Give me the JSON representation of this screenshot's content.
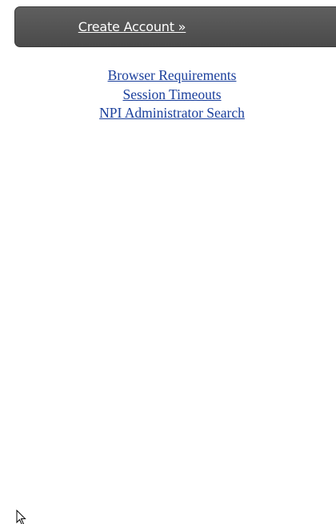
{
  "create_account": {
    "label": "Create Account »"
  },
  "links": [
    "Browser Requirements",
    "Session Timeouts",
    "NPI Administrator Search"
  ],
  "icons": {
    "cursor": "mouse-pointer-icon"
  }
}
